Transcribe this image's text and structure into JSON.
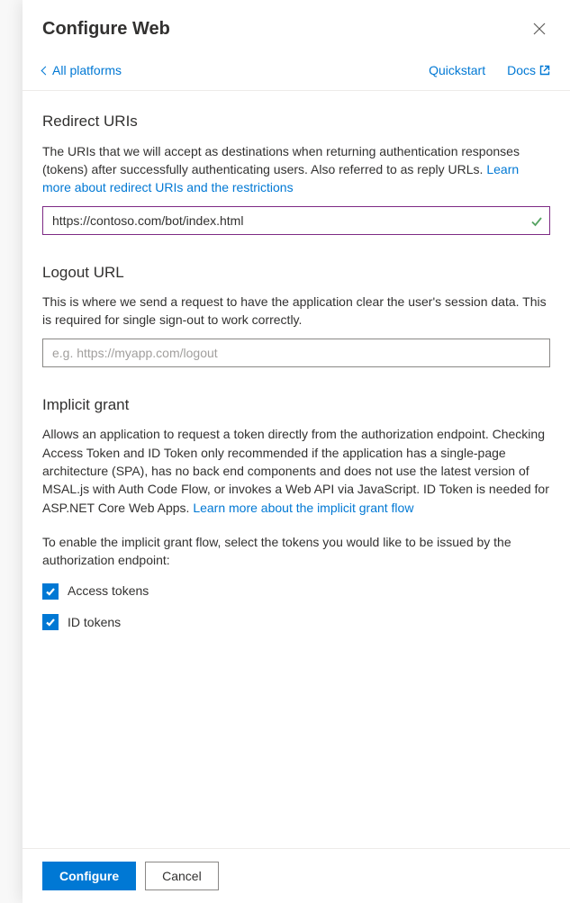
{
  "panel": {
    "title": "Configure Web"
  },
  "topbar": {
    "back": "All platforms",
    "quickstart": "Quickstart",
    "docs": "Docs"
  },
  "redirect": {
    "title": "Redirect URIs",
    "desc1": "The URIs that we will accept as destinations when returning authentication responses (tokens) after successfully authenticating users. Also referred to as reply URLs. ",
    "learnMore": "Learn more about redirect URIs and the restrictions",
    "value": "https://contoso.com/bot/index.html"
  },
  "logout": {
    "title": "Logout URL",
    "desc": "This is where we send a request to have the application clear the user's session data. This is required for single sign-out to work correctly.",
    "placeholder": "e.g. https://myapp.com/logout",
    "value": ""
  },
  "implicit": {
    "title": "Implicit grant",
    "desc1": "Allows an application to request a token directly from the authorization endpoint. Checking Access Token and ID Token only recommended if the application has a single-page architecture (SPA), has no back end components and does not use the latest version of MSAL.js with Auth Code Flow, or invokes a Web API via JavaScript. ID Token is needed for ASP.NET Core Web Apps. ",
    "learnMore": "Learn more about the implicit grant flow",
    "desc2": "To enable the implicit grant flow, select the tokens you would like to be issued by the authorization endpoint:",
    "accessTokens": "Access tokens",
    "idTokens": "ID tokens"
  },
  "footer": {
    "configure": "Configure",
    "cancel": "Cancel"
  }
}
